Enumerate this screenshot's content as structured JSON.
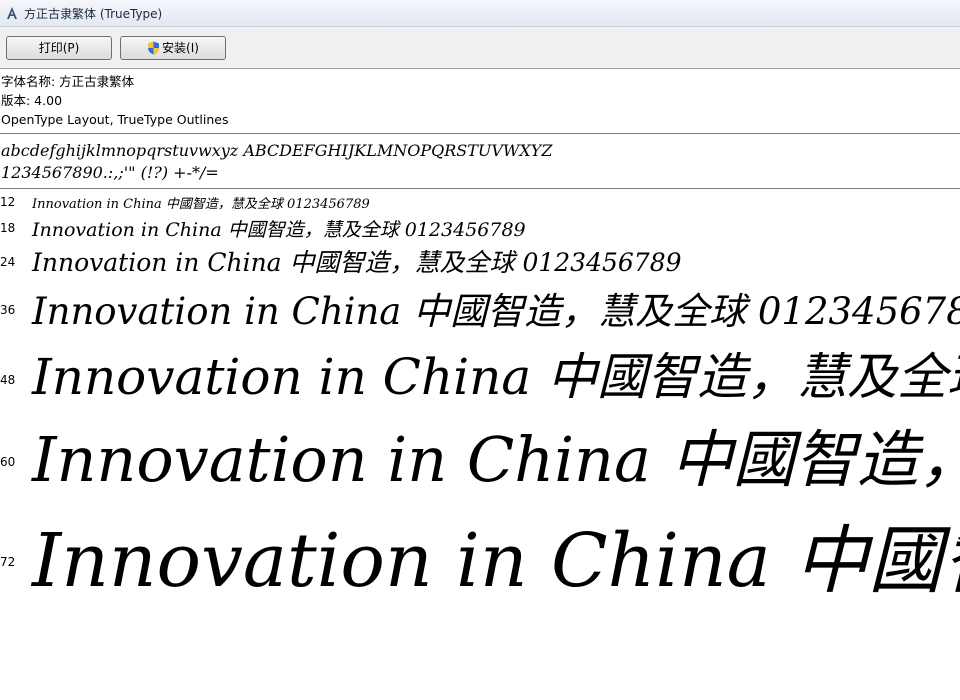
{
  "window": {
    "title": "方正古隶繁体 (TrueType)"
  },
  "toolbar": {
    "print_label": "打印(P)",
    "install_label": "安装(I)"
  },
  "font_info": {
    "name_line": "字体名称: 方正古隶繁体",
    "version_line": "版本: 4.00",
    "type_line": "OpenType Layout, TrueType Outlines"
  },
  "charset": {
    "letters": "abcdefghijklmnopqrstuvwxyz ABCDEFGHIJKLMNOPQRSTUVWXYZ",
    "digits": "1234567890.:,;'\" (!?) +-*/="
  },
  "samples": {
    "text": "Innovation in China 中國智造，慧及全球 0123456789",
    "rows": [
      {
        "size": "12"
      },
      {
        "size": "18"
      },
      {
        "size": "24"
      },
      {
        "size": "36"
      },
      {
        "size": "48"
      },
      {
        "size": "60"
      },
      {
        "size": "72"
      }
    ]
  }
}
